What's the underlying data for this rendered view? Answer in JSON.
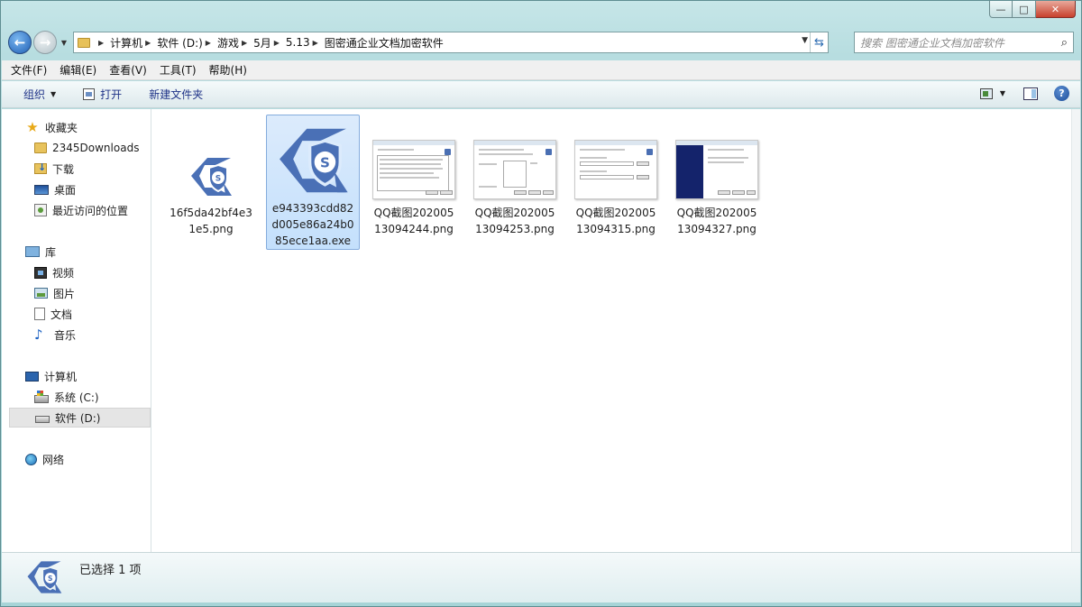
{
  "window": {
    "caption": {
      "minimize": "—",
      "maximize": "□",
      "close": "✕"
    }
  },
  "navigation": {
    "back_glyph": "←",
    "forward_glyph": "→",
    "breadcrumb": [
      "计算机",
      "软件 (D:)",
      "游戏",
      "5月",
      "5.13",
      "图密通企业文档加密软件"
    ],
    "search_placeholder": "搜索 图密通企业文档加密软件"
  },
  "menu": {
    "items": [
      "文件(F)",
      "编辑(E)",
      "查看(V)",
      "工具(T)",
      "帮助(H)"
    ]
  },
  "toolbar": {
    "organize": "组织",
    "open": "打开",
    "new_folder": "新建文件夹",
    "help": "?"
  },
  "sidebar": {
    "favorites": {
      "label": "收藏夹",
      "items": [
        "2345Downloads",
        "下载",
        "桌面",
        "最近访问的位置"
      ]
    },
    "libraries": {
      "label": "库",
      "items": [
        "视频",
        "图片",
        "文档",
        "音乐"
      ]
    },
    "computer": {
      "label": "计算机",
      "items": [
        "系统 (C:)",
        "软件 (D:)"
      ],
      "selected": "软件 (D:)"
    },
    "network": {
      "label": "网络"
    }
  },
  "files": [
    {
      "name": "16f5da42bf4e31e5.png",
      "kind": "app-icon-small",
      "selected": false
    },
    {
      "name": "e943393cdd82d005e86a24b085ece1aa.exe",
      "kind": "app-icon-large",
      "selected": true
    },
    {
      "name": "QQ截图20200513094244.png",
      "kind": "screenshot-license",
      "selected": false
    },
    {
      "name": "QQ截图20200513094253.png",
      "kind": "screenshot-path",
      "selected": false
    },
    {
      "name": "QQ截图20200513094315.png",
      "kind": "screenshot-form",
      "selected": false
    },
    {
      "name": "QQ截图20200513094327.png",
      "kind": "screenshot-finish",
      "selected": false
    }
  ],
  "details": {
    "status": "已选择 1 项"
  },
  "colors": {
    "app_icon_blue": "#4a70b6",
    "selection": "#cce4fc",
    "selection_border": "#84acdd"
  }
}
